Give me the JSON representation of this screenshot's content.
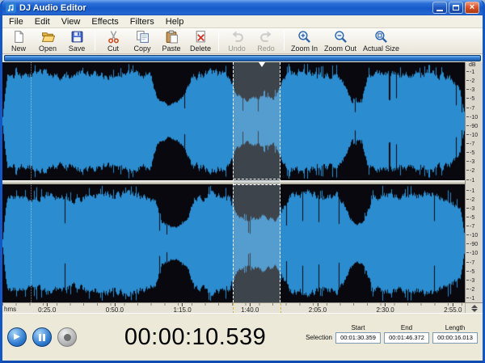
{
  "window": {
    "title": "DJ Audio Editor"
  },
  "menu": {
    "items": [
      "File",
      "Edit",
      "View",
      "Effects",
      "Filters",
      "Help"
    ]
  },
  "toolbar": {
    "buttons": [
      {
        "label": "New",
        "icon": "new-document-icon"
      },
      {
        "label": "Open",
        "icon": "open-folder-icon"
      },
      {
        "label": "Save",
        "icon": "save-icon",
        "group_end": true
      },
      {
        "label": "Cut",
        "icon": "scissors-icon"
      },
      {
        "label": "Copy",
        "icon": "copy-icon"
      },
      {
        "label": "Paste",
        "icon": "paste-icon"
      },
      {
        "label": "Delete",
        "icon": "delete-icon",
        "group_end": true
      },
      {
        "label": "Undo",
        "icon": "undo-icon",
        "disabled": true
      },
      {
        "label": "Redo",
        "icon": "redo-icon",
        "disabled": true,
        "group_end": true
      },
      {
        "label": "Zoom In",
        "icon": "zoom-in-icon"
      },
      {
        "label": "Zoom Out",
        "icon": "zoom-out-icon"
      },
      {
        "label": "Actual Size",
        "icon": "actual-size-icon"
      }
    ]
  },
  "waveform": {
    "db_unit": "dB",
    "db_labels": [
      "-1",
      "-2",
      "-3",
      "-5",
      "-7",
      "-10",
      "-90",
      "-10",
      "-7",
      "-5",
      "-3",
      "-2",
      "-1"
    ],
    "colors": {
      "wave": "#2b8ccf",
      "background": "#08080e",
      "selection_tint": "rgba(172,190,204,0.33)"
    },
    "selection": {
      "left_frac": 0.498,
      "width_frac": 0.104
    },
    "playhead_frac": 0.062,
    "envelope_top": [
      [
        0,
        0.08
      ],
      [
        0.01,
        0.9
      ],
      [
        0.05,
        0.84
      ],
      [
        0.09,
        0.95
      ],
      [
        0.13,
        0.8
      ],
      [
        0.18,
        0.92
      ],
      [
        0.23,
        0.86
      ],
      [
        0.28,
        0.94
      ],
      [
        0.32,
        0.88
      ],
      [
        0.335,
        0.42
      ],
      [
        0.36,
        0.3
      ],
      [
        0.39,
        0.44
      ],
      [
        0.41,
        0.86
      ],
      [
        0.45,
        0.93
      ],
      [
        0.49,
        0.85
      ],
      [
        0.505,
        0.52
      ],
      [
        0.53,
        0.4
      ],
      [
        0.56,
        0.5
      ],
      [
        0.585,
        0.44
      ],
      [
        0.6,
        0.62
      ],
      [
        0.615,
        0.92
      ],
      [
        0.65,
        0.95
      ],
      [
        0.69,
        0.86
      ],
      [
        0.72,
        0.9
      ],
      [
        0.74,
        0.68
      ],
      [
        0.755,
        0.38
      ],
      [
        0.775,
        0.36
      ],
      [
        0.79,
        0.86
      ],
      [
        0.84,
        0.93
      ],
      [
        0.88,
        0.88
      ],
      [
        0.92,
        0.94
      ],
      [
        0.96,
        0.85
      ],
      [
        0.985,
        0.7
      ],
      [
        1,
        0.12
      ]
    ],
    "envelope_bottom": [
      [
        0,
        0.08
      ],
      [
        0.01,
        0.88
      ],
      [
        0.06,
        0.86
      ],
      [
        0.1,
        0.93
      ],
      [
        0.15,
        0.82
      ],
      [
        0.2,
        0.9
      ],
      [
        0.26,
        0.92
      ],
      [
        0.31,
        0.9
      ],
      [
        0.33,
        0.78
      ],
      [
        0.345,
        0.4
      ],
      [
        0.37,
        0.3
      ],
      [
        0.4,
        0.42
      ],
      [
        0.415,
        0.88
      ],
      [
        0.46,
        0.94
      ],
      [
        0.49,
        0.86
      ],
      [
        0.51,
        0.5
      ],
      [
        0.535,
        0.42
      ],
      [
        0.565,
        0.52
      ],
      [
        0.59,
        0.45
      ],
      [
        0.605,
        0.66
      ],
      [
        0.62,
        0.93
      ],
      [
        0.66,
        0.95
      ],
      [
        0.7,
        0.87
      ],
      [
        0.725,
        0.91
      ],
      [
        0.745,
        0.62
      ],
      [
        0.76,
        0.36
      ],
      [
        0.78,
        0.4
      ],
      [
        0.8,
        0.88
      ],
      [
        0.85,
        0.93
      ],
      [
        0.89,
        0.9
      ],
      [
        0.93,
        0.94
      ],
      [
        0.965,
        0.85
      ],
      [
        0.99,
        0.66
      ],
      [
        1,
        0.1
      ]
    ]
  },
  "timeline": {
    "unit_label": "hms",
    "ticks": [
      "0:25.0",
      "0:50.0",
      "1:15.0",
      "1:40.0",
      "2:05.0",
      "2:30.0",
      "2:55.0"
    ],
    "first_tick_frac": 0.0965,
    "tick_spacing_frac": 0.1463
  },
  "transport": {
    "play": "play",
    "pause": "pause",
    "record": "record"
  },
  "time_display": {
    "value": "00:00:10.539"
  },
  "selection_panel": {
    "label": "Selection",
    "fields": [
      {
        "label": "Start",
        "value": "00:01:30.359"
      },
      {
        "label": "End",
        "value": "00:01:46.372"
      },
      {
        "label": "Length",
        "value": "00:00:16.013"
      }
    ]
  }
}
